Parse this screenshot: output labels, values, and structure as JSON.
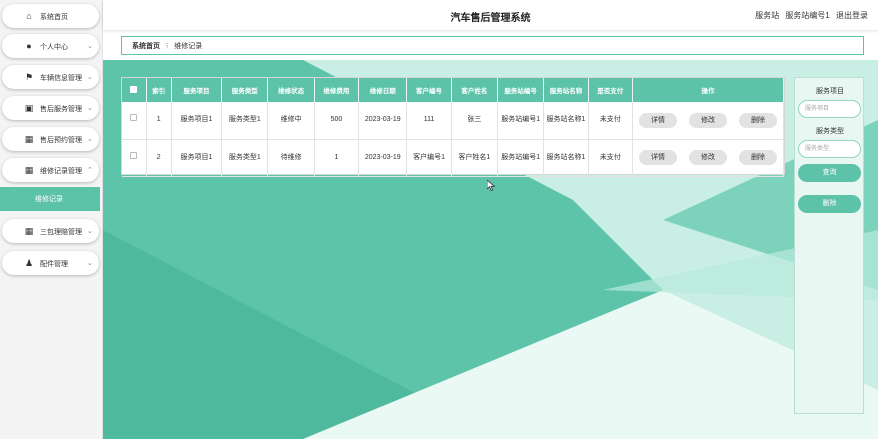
{
  "header": {
    "title": "汽车售后管理系统",
    "role": "服务站",
    "username": "服务站编号1",
    "logout": "退出登录"
  },
  "sidebar": {
    "items": [
      {
        "label": "系统首页",
        "icon": "home-icon",
        "chevron": false
      },
      {
        "label": "个人中心",
        "icon": "user-icon",
        "chevron": true
      },
      {
        "label": "车辆信息管理",
        "icon": "flag-icon",
        "chevron": true
      },
      {
        "label": "售后服务管理",
        "icon": "clipboard-icon",
        "chevron": true
      },
      {
        "label": "售后预约管理",
        "icon": "grid-icon",
        "chevron": true
      },
      {
        "label": "维修记录管理",
        "icon": "grid-icon",
        "chevron": true,
        "expanded": true
      },
      {
        "label": "三包理赔管理",
        "icon": "grid-icon",
        "chevron": true
      },
      {
        "label": "配件管理",
        "icon": "person-icon",
        "chevron": true
      }
    ],
    "active_sub": "维修记录"
  },
  "breadcrumb": {
    "home": "系统首页",
    "current": "维修记录"
  },
  "table": {
    "headers": [
      "索引",
      "服务项目",
      "服务类型",
      "维修状态",
      "维修费用",
      "维修日期",
      "客户编号",
      "客户姓名",
      "服务站编号",
      "服务站名称",
      "是否支付",
      "操作"
    ],
    "rows": [
      {
        "index": "1",
        "item": "服务项目1",
        "type": "服务类型1",
        "status": "维修中",
        "fee": "500",
        "date": "2023-03-19",
        "cust_no": "111",
        "cust_name": "张三",
        "station_no": "服务站编号1",
        "station_name": "服务站名称1",
        "paid": "未支付"
      },
      {
        "index": "2",
        "item": "服务项目1",
        "type": "服务类型1",
        "status": "待维修",
        "fee": "1",
        "date": "2023-03-19",
        "cust_no": "客户编号1",
        "cust_name": "客户姓名1",
        "station_no": "服务站编号1",
        "station_name": "服务站名称1",
        "paid": "未支付"
      }
    ],
    "actions": {
      "detail": "详情",
      "edit": "修改",
      "delete": "删除"
    }
  },
  "filter": {
    "item_label": "服务项目",
    "item_placeholder": "服务项目",
    "type_label": "服务类型",
    "type_placeholder": "服务类型",
    "search": "查询",
    "delete": "删除"
  },
  "colors": {
    "accent": "#5dc3a8",
    "button_gray": "#e2e2e2"
  }
}
